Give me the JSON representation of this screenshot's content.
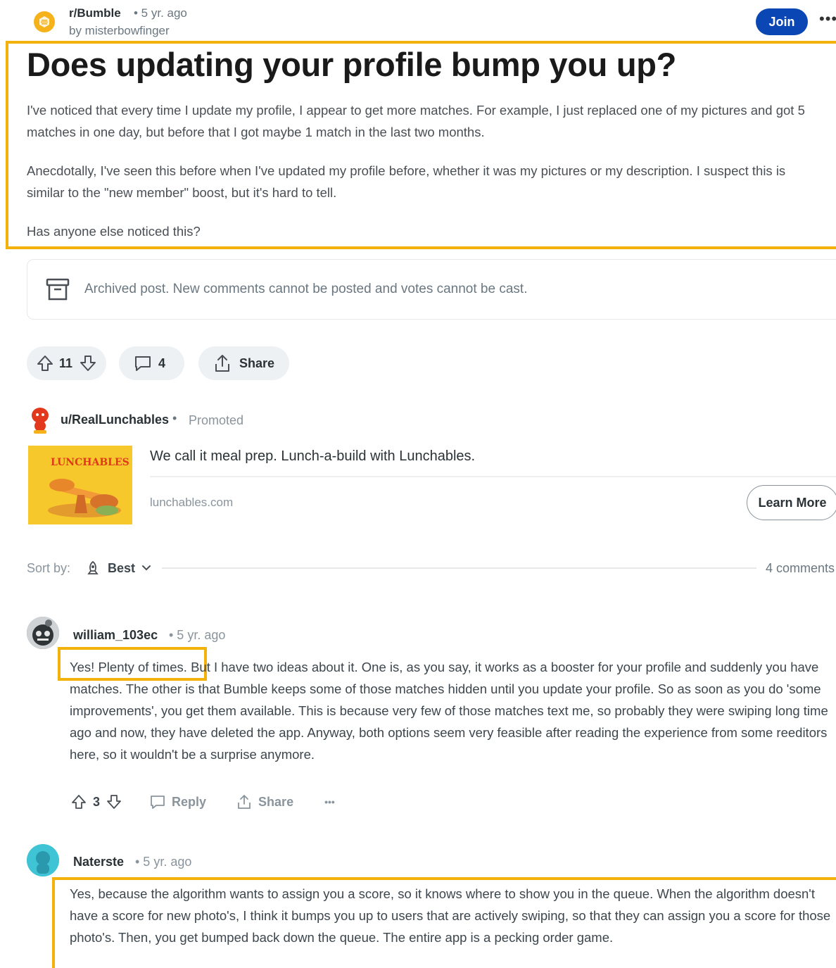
{
  "header": {
    "subreddit": "r/Bumble",
    "age": "• 5 yr. ago",
    "author": "by misterbowfinger",
    "join_label": "Join",
    "more_label": "•••"
  },
  "post": {
    "title": "Does updating your profile bump you up?",
    "paragraphs": [
      "I've noticed that every time I update my profile, I appear to get more matches. For example, I just replaced one of my pictures and got 5 matches in one day, but before that I got maybe 1 match in the last two months.",
      "Anecdotally, I've seen this before when I've updated my profile before, whether it was my pictures or my description. I suspect this is similar to the \"new member\" boost, but it's hard to tell.",
      "Has anyone else noticed this?"
    ],
    "archived_notice": "Archived post. New comments cannot be posted and votes cannot be cast.",
    "votes": "11",
    "comments": "4",
    "share_label": "Share"
  },
  "promoted": {
    "user": "u/RealLunchables",
    "dot": "•",
    "label": "Promoted",
    "title": "We call it meal prep. Lunch-a-build with Lunchables.",
    "domain": "lunchables.com",
    "cta": "Learn More",
    "thumb_text": "LUNCHABLES"
  },
  "sort": {
    "label": "Sort by:",
    "value": "Best",
    "count": "4 comments"
  },
  "comments": [
    {
      "user": "william_103ec",
      "meta": "• 5 yr. ago",
      "highlight": "Yes! Plenty of times.",
      "body": " But I have two ideas about it. One is, as you say, it works as a booster for your profile and suddenly you have matches. The other is that Bumble keeps some of those matches hidden until you update your profile. So as soon as you do 'some improvements', you get them available. This is because very few of those matches text me, so probably they were swiping long time ago and now, they have deleted the app. Anyway, both options seem very feasible after reading the experience from some reeditors here, so it wouldn't be a surprise anymore.",
      "votes": "3",
      "reply_label": "Reply",
      "share_label": "Share",
      "more_label": "•••"
    },
    {
      "user": "Naterste",
      "meta": "• 5 yr. ago",
      "body": "Yes, because the algorithm wants to assign you a score, so it knows where to show you in the queue. When the algorithm doesn't have a score for new photo's, I think it bumps you up to users that are actively swiping, so that they can assign you a score for those photo's. Then, you get bumped back down the queue. The entire app is a pecking order game."
    }
  ],
  "colors": {
    "highlight": "#f3b20b",
    "join": "#0b46b5",
    "subreddit_icon": "#f5b21b"
  }
}
